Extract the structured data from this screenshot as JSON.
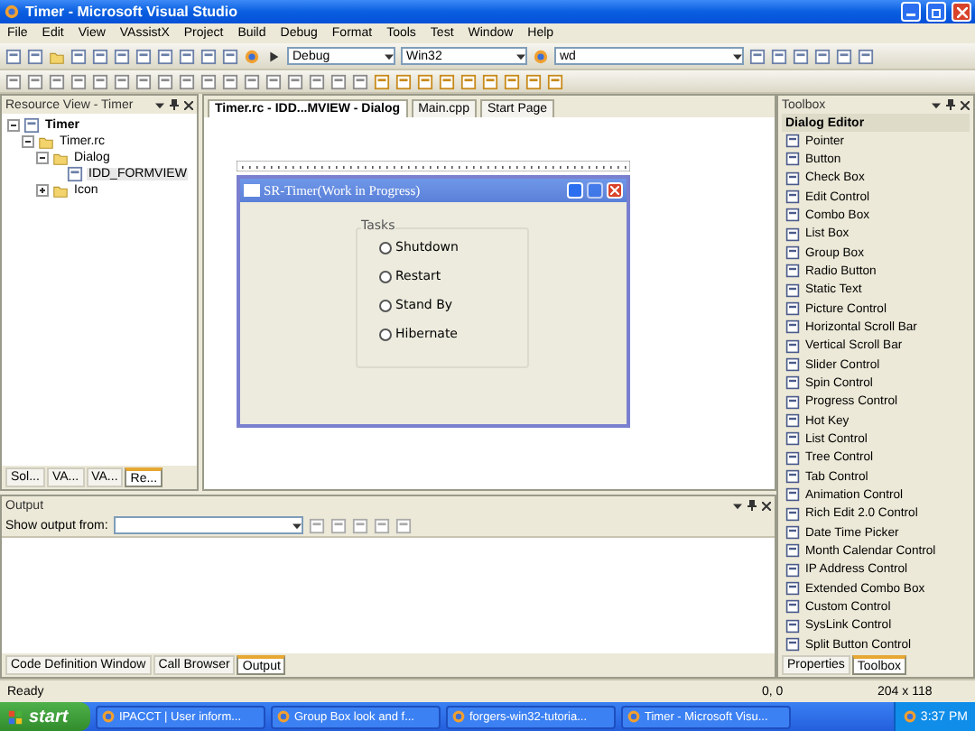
{
  "window": {
    "title": "Timer - Microsoft Visual Studio"
  },
  "menu": [
    "File",
    "Edit",
    "View",
    "VAssistX",
    "Project",
    "Build",
    "Debug",
    "Format",
    "Tools",
    "Test",
    "Window",
    "Help"
  ],
  "toolbar": {
    "configuration": "Debug",
    "platform": "Win32",
    "find": "wd"
  },
  "resource_view": {
    "title": "Resource View - Timer",
    "tree": [
      {
        "label": "Timer",
        "kind": "project",
        "selected": false,
        "expanded": true,
        "children": [
          {
            "label": "Timer.rc",
            "kind": "folder",
            "selected": false,
            "expanded": true,
            "children": [
              {
                "label": "Dialog",
                "kind": "folder",
                "selected": false,
                "expanded": true,
                "children": [
                  {
                    "label": "IDD_FORMVIEW",
                    "kind": "dialog",
                    "selected": true
                  }
                ]
              },
              {
                "label": "Icon",
                "kind": "folder",
                "selected": false,
                "expanded": false
              }
            ]
          }
        ]
      }
    ],
    "tabs": [
      {
        "label": "Sol...",
        "selected": false
      },
      {
        "label": "VA...",
        "selected": false
      },
      {
        "label": "VA...",
        "selected": false
      },
      {
        "label": "Re...",
        "selected": true
      }
    ]
  },
  "editor": {
    "tabs": [
      {
        "label": "Timer.rc - IDD...MVIEW - Dialog",
        "selected": true
      },
      {
        "label": "Main.cpp",
        "selected": false
      },
      {
        "label": "Start Page",
        "selected": false
      }
    ],
    "dialog": {
      "title": "SR-Timer(Work in Progress)",
      "group": "Tasks",
      "options": [
        {
          "label": "Shutdown",
          "selected": false
        },
        {
          "label": "Restart",
          "selected": false
        },
        {
          "label": "Stand By",
          "selected": false
        },
        {
          "label": "Hibernate",
          "selected": false
        }
      ]
    }
  },
  "toolbox": {
    "title": "Toolbox",
    "section": "Dialog Editor",
    "items": [
      "Pointer",
      "Button",
      "Check Box",
      "Edit Control",
      "Combo Box",
      "List Box",
      "Group Box",
      "Radio Button",
      "Static Text",
      "Picture Control",
      "Horizontal Scroll Bar",
      "Vertical Scroll Bar",
      "Slider Control",
      "Spin Control",
      "Progress Control",
      "Hot Key",
      "List Control",
      "Tree Control",
      "Tab Control",
      "Animation Control",
      "Rich Edit 2.0 Control",
      "Date Time Picker",
      "Month Calendar Control",
      "IP Address Control",
      "Extended Combo Box",
      "Custom Control",
      "SysLink Control",
      "Split Button Control"
    ],
    "tabs": [
      {
        "label": "Properties",
        "selected": false
      },
      {
        "label": "Toolbox",
        "selected": true
      }
    ]
  },
  "output": {
    "title": "Output",
    "show_from_label": "Show output from:",
    "tabs": [
      {
        "label": "Code Definition Window",
        "selected": false
      },
      {
        "label": "Call Browser",
        "selected": false
      },
      {
        "label": "Output",
        "selected": true
      }
    ]
  },
  "status_bar": {
    "message": "Ready",
    "position": "0, 0",
    "size": "204 x 118"
  },
  "taskbar": {
    "start": "start",
    "tasks": [
      "IPACCT | User inform...",
      "Group Box look and f...",
      "forgers-win32-tutoria...",
      "Timer - Microsoft Visu..."
    ],
    "clock": "3:37 PM"
  }
}
